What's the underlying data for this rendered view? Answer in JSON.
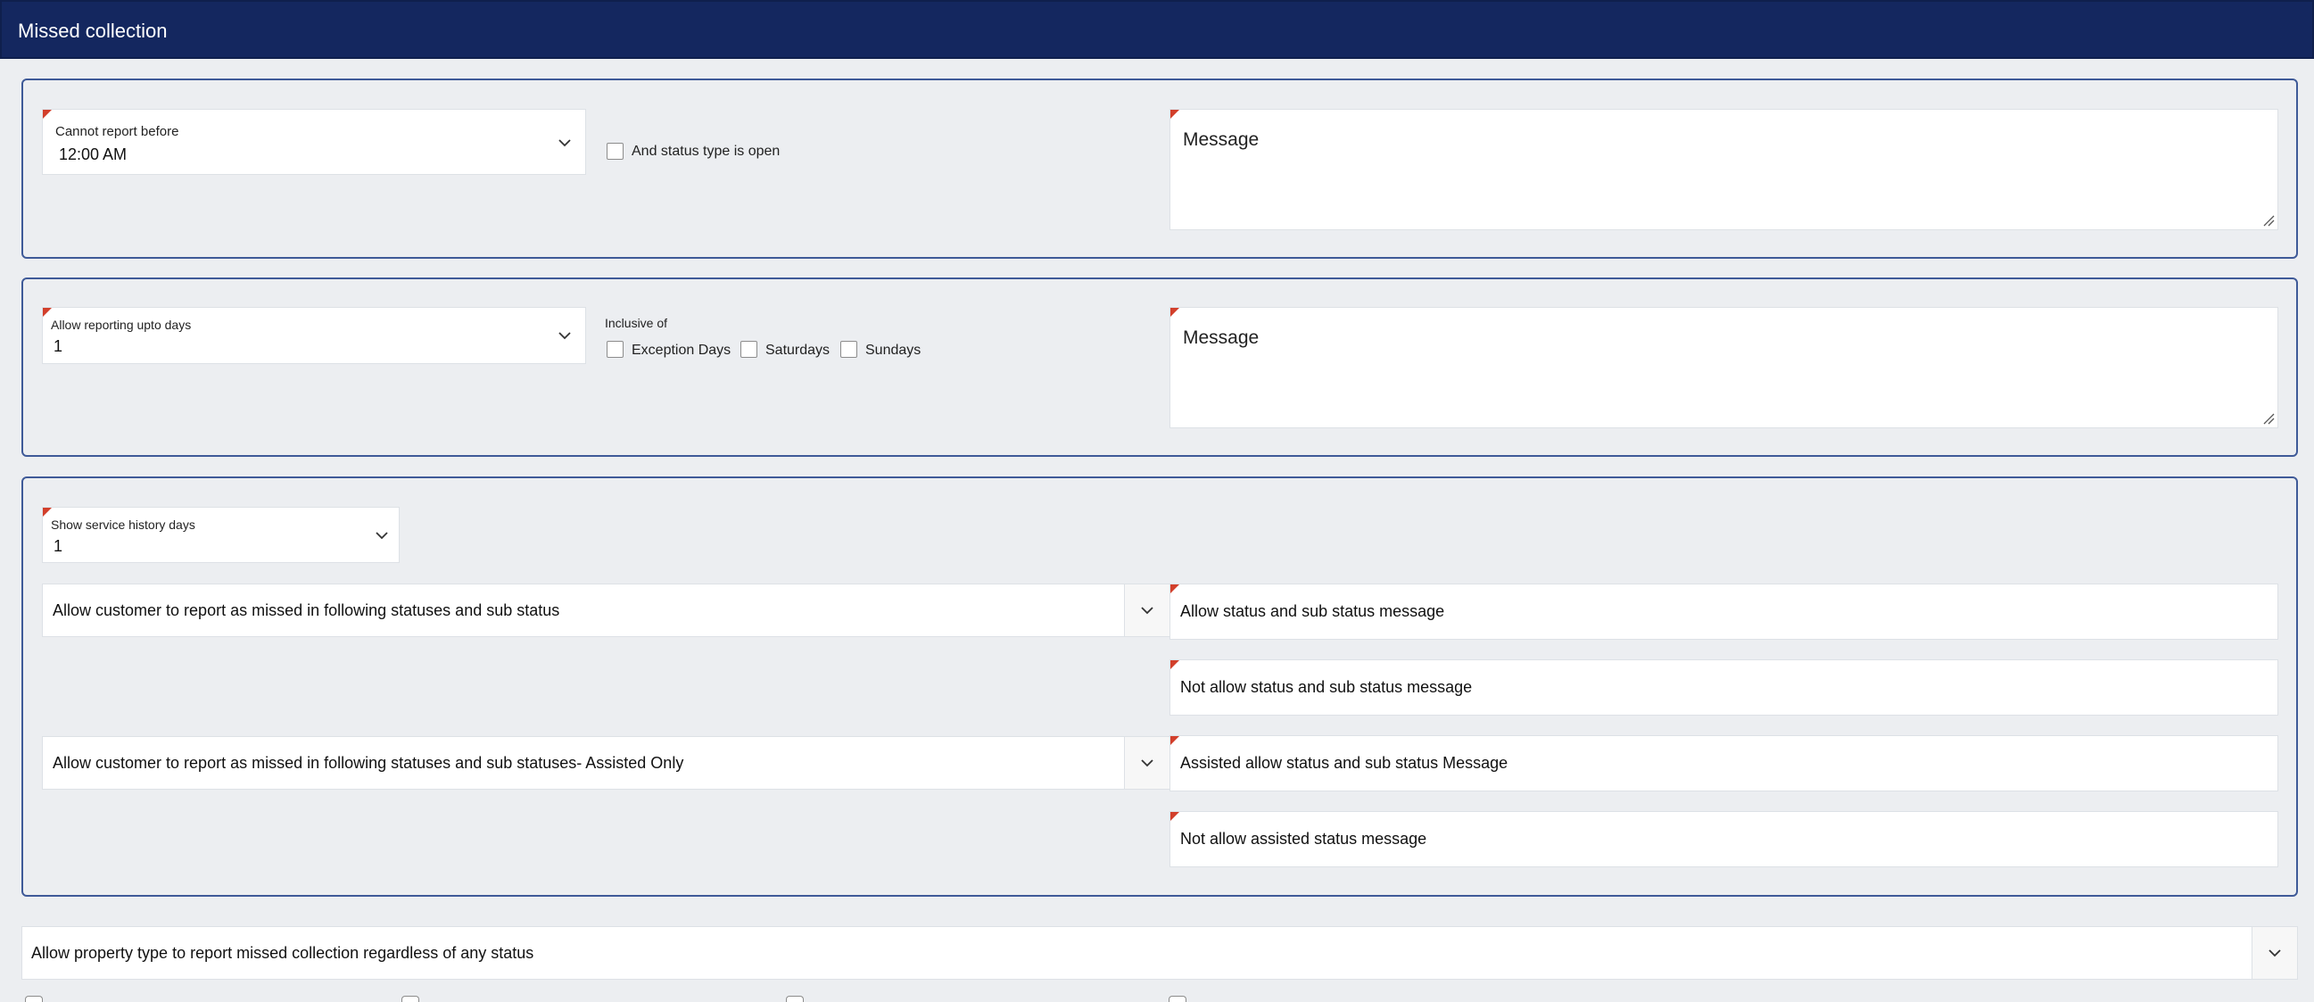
{
  "header": {
    "title": "Missed collection"
  },
  "section1": {
    "dropdown_label": "Cannot report before",
    "dropdown_value": "12:00 AM",
    "checkbox_label": "And status type is open",
    "message_placeholder": "Message"
  },
  "section2": {
    "dropdown_label": "Allow reporting upto days",
    "dropdown_value": "1",
    "inclusive_label": "Inclusive of",
    "options": [
      "Exception Days",
      "Saturdays",
      "Sundays"
    ],
    "message_placeholder": "Message"
  },
  "section3": {
    "history_label": "Show service history days",
    "history_value": "1",
    "statuses_select": "Allow customer to report as missed in following statuses and sub status",
    "assisted_select": "Allow customer to report as missed in following statuses and sub statuses- Assisted Only",
    "allow_msg": "Allow status and sub status message",
    "not_allow_msg": "Not allow status and sub status message",
    "assisted_allow_msg": "Assisted allow status and sub status Message",
    "not_allow_assisted_msg": "Not allow assisted status message"
  },
  "property_select": "Allow property type to report missed collection regardless of any status",
  "icons": {
    "chevron": "chevron-down-icon",
    "resize": "resize-handle-icon"
  },
  "colors": {
    "header_bg": "#14275f",
    "panel_border": "#3f5a98",
    "required_marker": "#d23f2b",
    "page_bg": "#eceef1"
  }
}
